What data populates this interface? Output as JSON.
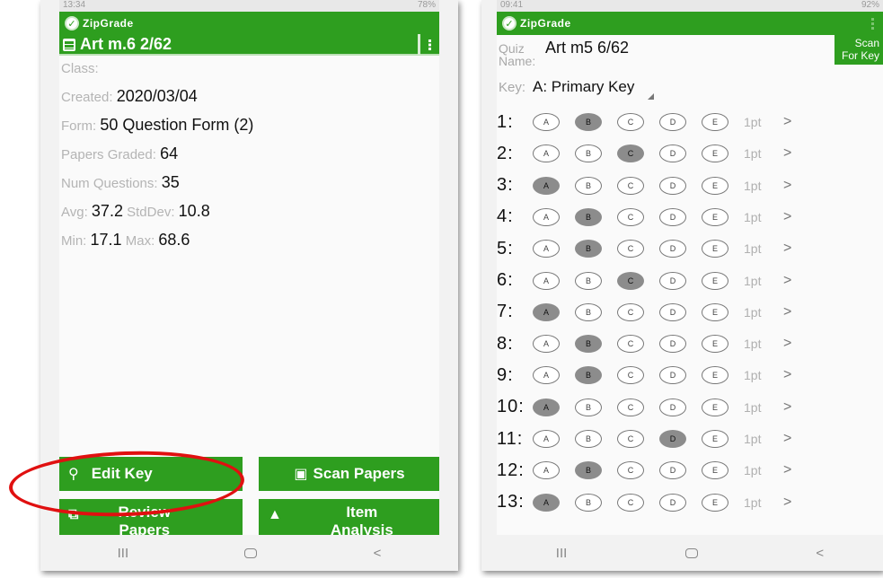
{
  "left": {
    "status_time": "13:34",
    "status_right": "78%",
    "brand": "ZipGrade",
    "title": "Art m.6 2/62",
    "fields": [
      {
        "label": "Class:",
        "value": ""
      },
      {
        "label": "Created: ",
        "value": "2020/03/04"
      },
      {
        "label": "Form: ",
        "value": "50 Question Form (2)"
      },
      {
        "label": "Papers Graded: ",
        "value": "64"
      },
      {
        "label": "Num Questions: ",
        "value": "35"
      }
    ],
    "avg_label": "Avg: ",
    "avg_value": "37.2",
    "stddev_label": " StdDev: ",
    "stddev_value": "10.8",
    "min_label": "Min: ",
    "min_value": "17.1",
    "max_label": " Max: ",
    "max_value": "68.6",
    "buttons": {
      "edit_key": "Edit Key",
      "scan_papers": "Scan Papers",
      "review_papers_1": "Review",
      "review_papers_2": "Papers",
      "item_analysis_1": "Item",
      "item_analysis_2": "Analysis"
    },
    "icons": {
      "edit_key": "key-icon",
      "scan_papers": "camera-icon",
      "review_papers": "copy-icon",
      "item_analysis": "graduation-cap-icon"
    }
  },
  "right": {
    "status_time": "09:41",
    "status_right": "92%",
    "brand": "ZipGrade",
    "quiz_label_1": "Quiz",
    "quiz_label_2": "Name:",
    "quiz_name": "Art m5 6/62",
    "scan_key_1": "Scan",
    "scan_key_2": "For Key",
    "key_label": "Key:",
    "key_value": "A: Primary Key",
    "choices": [
      "A",
      "B",
      "C",
      "D",
      "E"
    ],
    "questions": [
      {
        "num": "1:",
        "answer": "B",
        "points": "1pt"
      },
      {
        "num": "2:",
        "answer": "C",
        "points": "1pt"
      },
      {
        "num": "3:",
        "answer": "A",
        "points": "1pt"
      },
      {
        "num": "4:",
        "answer": "B",
        "points": "1pt"
      },
      {
        "num": "5:",
        "answer": "B",
        "points": "1pt"
      },
      {
        "num": "6:",
        "answer": "C",
        "points": "1pt"
      },
      {
        "num": "7:",
        "answer": "A",
        "points": "1pt"
      },
      {
        "num": "8:",
        "answer": "B",
        "points": "1pt"
      },
      {
        "num": "9:",
        "answer": "B",
        "points": "1pt"
      },
      {
        "num": "10:",
        "answer": "A",
        "points": "1pt"
      },
      {
        "num": "11:",
        "answer": "D",
        "points": "1pt"
      },
      {
        "num": "12:",
        "answer": "B",
        "points": "1pt"
      },
      {
        "num": "13:",
        "answer": "A",
        "points": "1pt"
      }
    ]
  },
  "nav": {
    "recent": "III",
    "back": "<"
  },
  "colors": {
    "accent": "#2e9e1f",
    "highlight": "#e01010",
    "filled_bubble": "#8c8c8c"
  }
}
